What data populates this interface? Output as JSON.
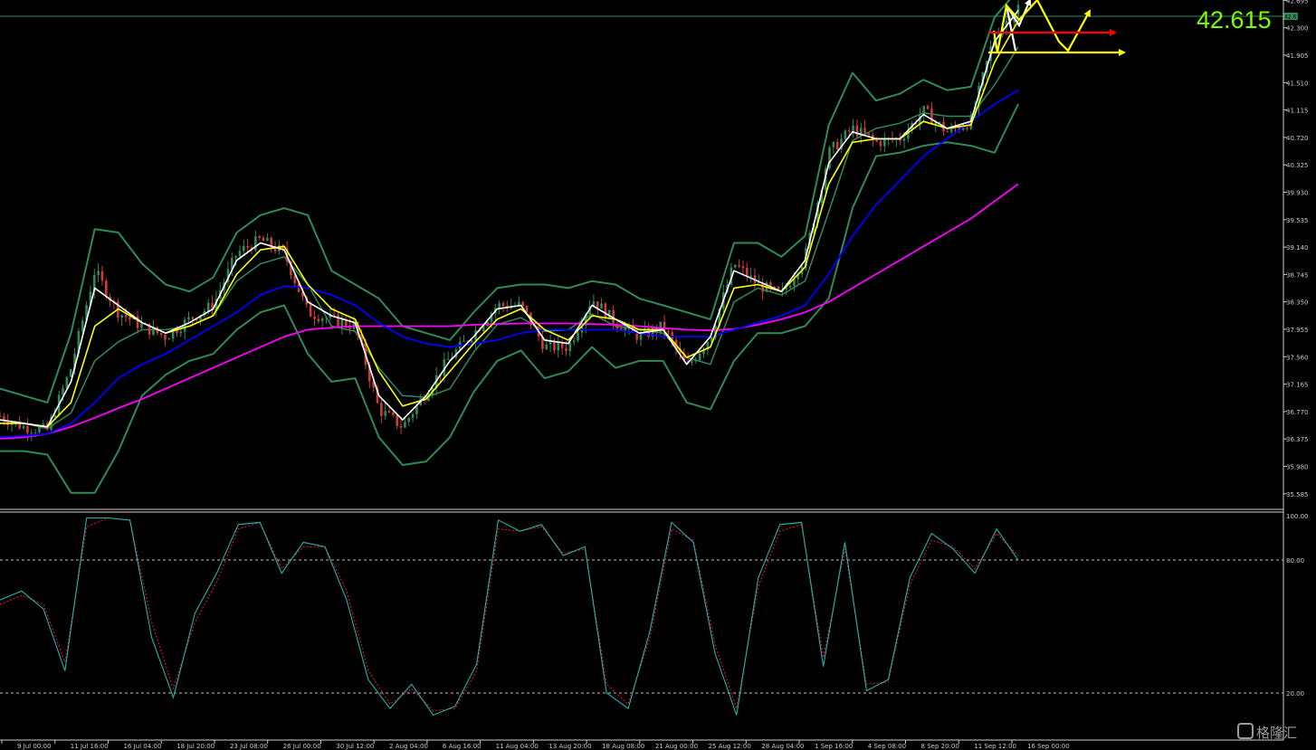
{
  "chart_data": [
    {
      "type": "candlestick",
      "title": "",
      "last_price": "42.615",
      "last_price_tag": "42.615",
      "ylim": [
        35.4,
        42.7
      ],
      "y_ticks": [
        "42.695",
        "42.300",
        "41.905",
        "41.510",
        "41.115",
        "40.720",
        "40.325",
        "39.930",
        "39.535",
        "39.140",
        "38.745",
        "38.350",
        "37.955",
        "37.560",
        "37.165",
        "36.770",
        "36.375",
        "35.980",
        "35.585"
      ],
      "x_ticks": [
        "9 Jul 00:00",
        "11 Jul 16:00",
        "16 Jul 04:00",
        "18 Jul 20:00",
        "23 Jul 08:00",
        "26 Jul 00:00",
        "30 Jul 12:00",
        "2 Aug 04:00",
        "6 Aug 16:00",
        "11 Aug 04:00",
        "13 Aug 20:00",
        "18 Aug 08:00",
        "21 Aug 00:00",
        "25 Aug 12:00",
        "28 Aug 04:00",
        "1 Sep 16:00",
        "4 Sep 08:00",
        "8 Sep 20:00",
        "11 Sep 12:00",
        "16 Sep 00:00"
      ],
      "series": [
        {
          "key": "close",
          "values": [
            36.7,
            36.55,
            36.5,
            37.4,
            38.8,
            38.2,
            38.0,
            37.85,
            38.1,
            38.3,
            39.05,
            39.25,
            39.05,
            38.2,
            38.1,
            38.0,
            36.8,
            36.55,
            37.05,
            37.55,
            37.9,
            38.3,
            38.3,
            37.7,
            37.7,
            38.4,
            38.05,
            37.85,
            38.0,
            37.4,
            37.85,
            38.9,
            38.6,
            38.45,
            39.0,
            40.5,
            40.85,
            40.65,
            40.7,
            41.1,
            40.8,
            40.95,
            42.2,
            42.6
          ]
        },
        {
          "key": "ma_fast",
          "color": "#ffffff",
          "values": [
            36.65,
            36.6,
            36.55,
            37.2,
            38.55,
            38.3,
            38.05,
            37.9,
            38.05,
            38.25,
            38.95,
            39.2,
            39.1,
            38.35,
            38.15,
            38.05,
            37.0,
            36.65,
            37.0,
            37.5,
            37.85,
            38.25,
            38.3,
            37.8,
            37.75,
            38.3,
            38.1,
            37.9,
            37.95,
            37.45,
            37.85,
            38.8,
            38.65,
            38.5,
            38.95,
            40.35,
            40.8,
            40.7,
            40.7,
            41.05,
            40.85,
            40.95,
            42.1,
            42.55
          ]
        },
        {
          "key": "ma_medium",
          "color": "#ffff00",
          "values": [
            36.6,
            36.6,
            36.55,
            36.9,
            38.0,
            38.25,
            38.05,
            37.9,
            38.0,
            38.15,
            38.75,
            39.1,
            39.15,
            38.6,
            38.25,
            38.1,
            37.35,
            36.85,
            36.95,
            37.35,
            37.75,
            38.1,
            38.25,
            37.95,
            37.8,
            38.15,
            38.1,
            37.95,
            37.95,
            37.55,
            37.7,
            38.55,
            38.6,
            38.5,
            38.85,
            40.05,
            40.65,
            40.7,
            40.7,
            40.95,
            40.85,
            40.9,
            41.8,
            42.4
          ]
        },
        {
          "key": "ma_slow",
          "color": "#0000ff",
          "values": [
            36.4,
            36.42,
            36.45,
            36.6,
            36.9,
            37.25,
            37.45,
            37.6,
            37.8,
            38.0,
            38.2,
            38.45,
            38.58,
            38.55,
            38.45,
            38.3,
            38.05,
            37.85,
            37.75,
            37.7,
            37.75,
            37.8,
            37.9,
            37.95,
            37.95,
            37.95,
            37.95,
            37.9,
            37.85,
            37.85,
            37.85,
            37.95,
            38.05,
            38.15,
            38.3,
            38.75,
            39.3,
            39.75,
            40.1,
            40.45,
            40.7,
            40.95,
            41.2,
            41.4
          ]
        },
        {
          "key": "ma_long",
          "color": "#ff00ff",
          "values": [
            36.38,
            36.4,
            36.45,
            36.55,
            36.68,
            36.82,
            36.95,
            37.1,
            37.25,
            37.4,
            37.55,
            37.7,
            37.85,
            37.95,
            37.98,
            38.0,
            38.0,
            38.0,
            38.0,
            38.0,
            38.02,
            38.03,
            38.04,
            38.04,
            38.04,
            38.03,
            38.02,
            38.0,
            37.97,
            37.95,
            37.94,
            37.96,
            38.02,
            38.1,
            38.2,
            38.35,
            38.55,
            38.75,
            38.95,
            39.15,
            39.35,
            39.55,
            39.8,
            40.05
          ]
        },
        {
          "key": "bb_upper",
          "color": "#2e8b57",
          "values": [
            37.1,
            37.0,
            36.9,
            37.9,
            39.4,
            39.35,
            38.9,
            38.6,
            38.5,
            38.7,
            39.35,
            39.6,
            39.7,
            39.6,
            38.8,
            38.6,
            38.4,
            38.0,
            37.9,
            37.8,
            38.2,
            38.55,
            38.6,
            38.6,
            38.55,
            38.65,
            38.6,
            38.4,
            38.3,
            38.2,
            38.1,
            39.2,
            39.2,
            39.0,
            39.3,
            40.9,
            41.65,
            41.25,
            41.35,
            41.55,
            41.4,
            41.45,
            42.45,
            42.85
          ]
        },
        {
          "key": "bb_lower",
          "color": "#2e8b57",
          "values": [
            36.2,
            36.2,
            36.15,
            35.6,
            35.6,
            36.2,
            37.0,
            37.3,
            37.5,
            37.6,
            37.95,
            38.2,
            38.3,
            37.6,
            37.2,
            37.25,
            36.4,
            36.0,
            36.05,
            36.4,
            37.05,
            37.5,
            37.65,
            37.25,
            37.35,
            37.7,
            37.4,
            37.5,
            37.5,
            36.9,
            36.8,
            37.5,
            37.9,
            37.9,
            38.0,
            38.4,
            39.7,
            40.45,
            40.5,
            40.6,
            40.65,
            40.6,
            40.5,
            41.2
          ]
        }
      ],
      "projection_arrows": [
        {
          "color": "#ffffff",
          "points": [
            [
              1122,
              56
            ],
            [
              1112,
              6
            ],
            [
              1126,
              28
            ],
            [
              1138,
              0
            ]
          ]
        },
        {
          "color": "#ffff00",
          "points": [
            [
              1098,
              34
            ],
            [
              1102,
              58
            ],
            [
              1112,
              6
            ],
            [
              1126,
              22
            ],
            [
              1146,
              0
            ],
            [
              1170,
              46
            ],
            [
              1180,
              56
            ],
            [
              1204,
              12
            ]
          ]
        },
        {
          "color": "#ff0000",
          "horizontal": {
            "y": 36,
            "x1": 1092,
            "x2": 1232
          }
        },
        {
          "color": "#ffff00",
          "horizontal": {
            "y": 58,
            "x1": 1092,
            "x2": 1242
          }
        }
      ]
    },
    {
      "type": "line",
      "title": "",
      "ylim": [
        0,
        100
      ],
      "y_ticks": [
        "100.00",
        "80.00",
        "20.00"
      ],
      "levels": [
        80,
        20
      ],
      "series": [
        {
          "key": "k",
          "color": "#20b2aa",
          "values": [
            62,
            66,
            58,
            30,
            99,
            99,
            98,
            45,
            18,
            56,
            74,
            96,
            97,
            74,
            88,
            86,
            62,
            26,
            13,
            24,
            10,
            14,
            33,
            98,
            93,
            96,
            82,
            86,
            20,
            13,
            48,
            97,
            88,
            38,
            10,
            72,
            96,
            97,
            32,
            88,
            21,
            26,
            72,
            92,
            85,
            74,
            94,
            80
          ]
        },
        {
          "key": "d",
          "color": "#dc143c",
          "values": [
            60,
            64,
            60,
            34,
            95,
            99,
            98,
            52,
            22,
            52,
            70,
            94,
            97,
            76,
            86,
            86,
            66,
            30,
            15,
            22,
            12,
            13,
            30,
            94,
            93,
            95,
            83,
            85,
            24,
            15,
            45,
            94,
            89,
            42,
            13,
            68,
            93,
            96,
            36,
            85,
            24,
            25,
            69,
            89,
            86,
            76,
            92,
            82
          ]
        }
      ]
    }
  ],
  "watermark": "格隆汇"
}
